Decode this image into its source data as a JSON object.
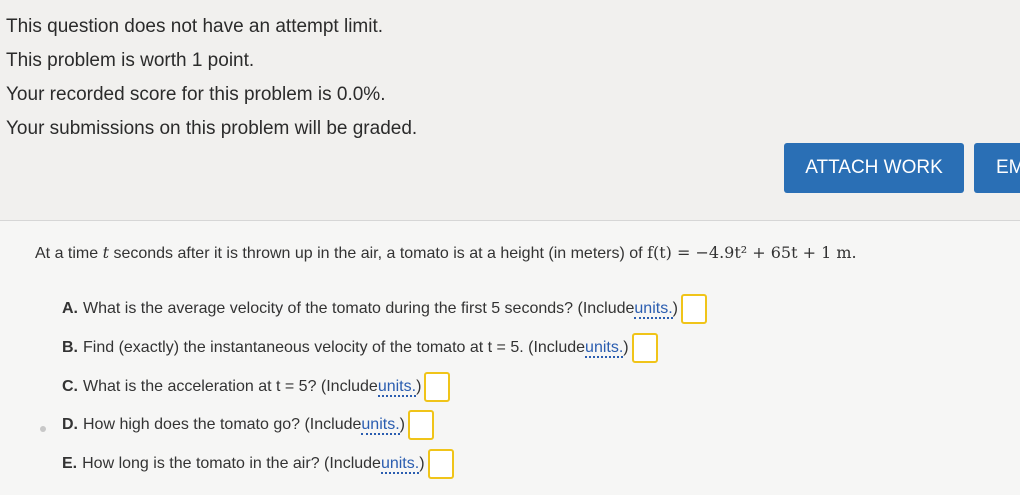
{
  "info": [
    "This question does not have an attempt limit.",
    "This problem is worth 1 point.",
    "Your recorded score for this problem is 0.0%.",
    "Your submissions on this problem will be graded."
  ],
  "buttons": {
    "attach": "ATTACH WORK",
    "email": "EM"
  },
  "problem": {
    "intro_a": "At a time ",
    "var_t": "t",
    "intro_b": " seconds after it is thrown up in the air, a tomato is at a height (in meters) of ",
    "func": "f(t) = −4.9t² + 65t + 1 m."
  },
  "questions": [
    {
      "label": "A.",
      "text": "What is the average velocity of the tomato during the first 5 seconds? (Include ",
      "units": "units.",
      "close": ")"
    },
    {
      "label": "B.",
      "text": "Find (exactly) the instantaneous velocity of the tomato at t = 5. (Include ",
      "units": "units.",
      "close": ")"
    },
    {
      "label": "C.",
      "text": "What is the acceleration at t = 5? (Include ",
      "units": "units.",
      "close": ")"
    },
    {
      "label": "D.",
      "text": "How high does the tomato go? (Include ",
      "units": "units.",
      "close": ")"
    },
    {
      "label": "E.",
      "text": "How long is the tomato in the air? (Include ",
      "units": "units.",
      "close": ")"
    }
  ]
}
